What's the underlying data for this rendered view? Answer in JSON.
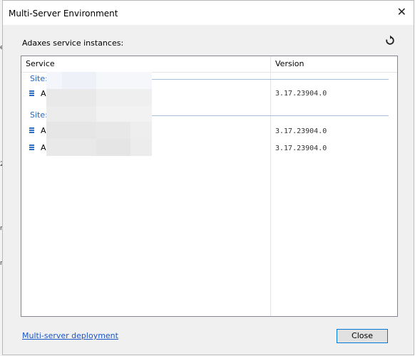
{
  "window": {
    "title": "Multi-Server Environment",
    "close_glyph": "✕"
  },
  "label": "Adaxes service instances:",
  "refresh_icon": "refresh-icon",
  "columns": {
    "service": "Service",
    "version": "Version"
  },
  "groups": [
    {
      "label": "Site:",
      "rows": [
        {
          "name": "A",
          "version": "3.17.23904.0"
        }
      ]
    },
    {
      "label": "Site:",
      "rows": [
        {
          "name": "A",
          "version": "3.17.23904.0"
        },
        {
          "name": "A",
          "version": "3.17.23904.0"
        }
      ]
    }
  ],
  "footer": {
    "link": "Multi-server deployment",
    "close_button": "Close"
  },
  "background_chars": [
    "e",
    "2",
    "r",
    "n"
  ],
  "colors": {
    "accent": "#0078d7",
    "group": "#1e64c8",
    "link": "#1a55c9"
  }
}
